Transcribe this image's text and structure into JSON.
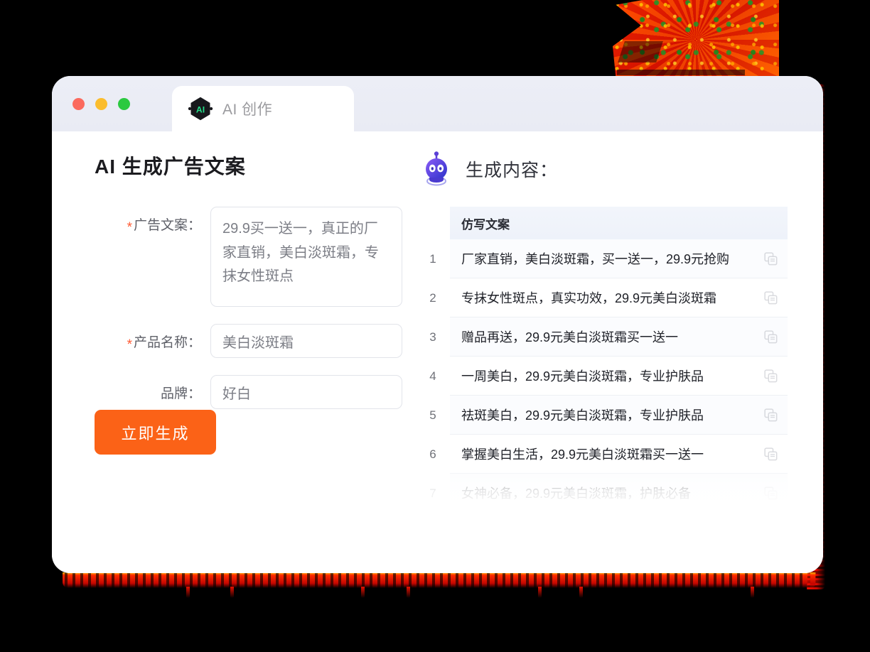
{
  "background_color": "#000000",
  "window": {
    "traffic_lights": [
      {
        "name": "close",
        "color": "#fb6a5e"
      },
      {
        "name": "minimize",
        "color": "#fbbd2e"
      },
      {
        "name": "maximize",
        "color": "#2bc940"
      }
    ],
    "tab": {
      "icon": "ai-hexagon-icon",
      "icon_text": "AI",
      "label": "AI 创作"
    }
  },
  "left_panel": {
    "title": "AI 生成广告文案",
    "required_marker": "*",
    "fields": [
      {
        "label": "广告文案：",
        "required": true,
        "type": "textarea",
        "value": "29.9买一送一，真正的厂家直销，美白淡斑霜，专抹女性斑点"
      },
      {
        "label": "产品名称：",
        "required": true,
        "type": "input",
        "value": "美白淡斑霜"
      },
      {
        "label": "品牌：",
        "required": false,
        "type": "input",
        "value": "好白"
      }
    ],
    "submit_button": {
      "label": "立即生成",
      "color": "#fb6217"
    }
  },
  "right_panel": {
    "icon": "robot-icon",
    "title": "生成内容：",
    "table": {
      "column_header": "仿写文案",
      "rows": [
        {
          "num": "1",
          "text": "厂家直销，美白淡斑霜，买一送一，29.9元抢购"
        },
        {
          "num": "2",
          "text": "专抹女性斑点，真实功效，29.9元美白淡斑霜"
        },
        {
          "num": "3",
          "text": "赠品再送，29.9元美白淡斑霜买一送一"
        },
        {
          "num": "4",
          "text": "一周美白，29.9元美白淡斑霜，专业护肤品"
        },
        {
          "num": "5",
          "text": "祛斑美白，29.9元美白淡斑霜，专业护肤品"
        },
        {
          "num": "6",
          "text": "掌握美白生活，29.9元美白淡斑霜买一送一"
        },
        {
          "num": "7",
          "text": "女神必备，29.9元美白淡斑霜，护肤必备"
        }
      ],
      "row_action_icon": "copy-icon"
    }
  },
  "decoration": {
    "accent_red": "#ff2a00",
    "glow_red": "#e81000"
  }
}
